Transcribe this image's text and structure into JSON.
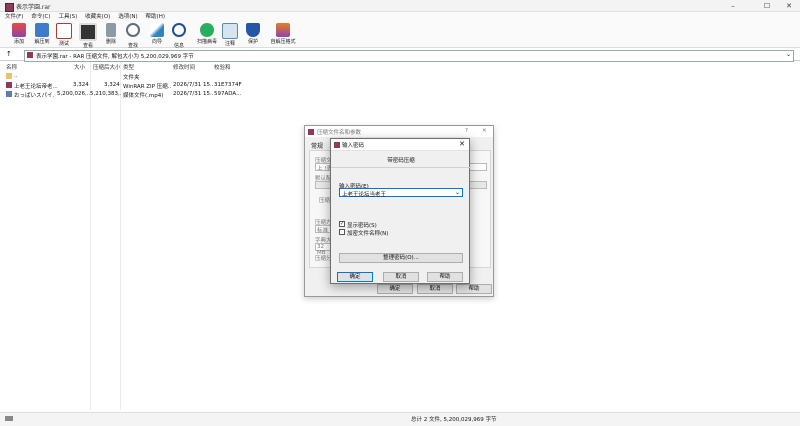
{
  "window": {
    "title": "表示学園.rar",
    "controls": [
      "–",
      "☐",
      "✕"
    ]
  },
  "menu": [
    "文件(F)",
    "命令(C)",
    "工具(S)",
    "收藏夹(O)",
    "选项(N)",
    "帮助(H)"
  ],
  "toolbar": [
    {
      "label": "添加",
      "icon": "add-archive-icon",
      "color": "#c0392b"
    },
    {
      "label": "解压到",
      "icon": "extract-to-icon",
      "color": "#3d7cc9"
    },
    {
      "label": "测试",
      "icon": "test-icon",
      "color": "#b03a2e"
    },
    {
      "label": "查看",
      "icon": "view-icon",
      "color": "#444444"
    },
    {
      "label": "删除",
      "icon": "delete-icon",
      "color": "#7f8c8d"
    },
    {
      "label": "查找",
      "icon": "find-icon",
      "color": "#5d6d7e"
    },
    {
      "label": "向导",
      "icon": "wizard-icon",
      "color": "#2e86c1"
    },
    {
      "label": "信息",
      "icon": "info-icon",
      "color": "#1f4e9c"
    },
    {
      "label": "扫描病毒",
      "icon": "virus-scan-icon",
      "color": "#27ae60"
    },
    {
      "label": "注释",
      "icon": "comment-icon",
      "color": "#5d8aa8"
    },
    {
      "label": "保护",
      "icon": "protect-icon",
      "color": "#2457a6"
    },
    {
      "label": "自解压格式",
      "icon": "sfx-icon",
      "color": "#d35400"
    }
  ],
  "pathbar": {
    "up": "↑",
    "text": "表示学園.rar - RAR 压缩文件, 解包大小为 5,200,029,969 字节",
    "dropdown": "⌄"
  },
  "columns": [
    "名称",
    "大小",
    "压缩后大小",
    "类型",
    "修改时间",
    "校验和"
  ],
  "files": [
    {
      "name": "..",
      "size": "",
      "packed": "",
      "type": "文件夹",
      "modified": "",
      "crc": ""
    },
    {
      "name": "上老王论坛帝老...",
      "size": "3,324",
      "packed": "3,324",
      "type": "WinRAR ZIP 压缩...",
      "modified": "2026/7/31 15...",
      "crc": "31E7374F"
    },
    {
      "name": "おっぱいスパイ...",
      "size": "5,200,026,...",
      "packed": "5,210,383,...",
      "type": "媒体文件(.mp4)",
      "modified": "2026/7/31 15...",
      "crc": "597ADA..."
    }
  ],
  "status": {
    "left_icon": "drive-icon",
    "left": "",
    "right": "总计 2 文件, 5,200,029,969 字节"
  },
  "back_dialog": {
    "title": "压缩文件名和参数",
    "help": "?",
    "close": "✕",
    "tab_general": "常规",
    "labels": [
      "压缩文",
      "上 !表",
      "默认配",
      "压缩",
      "压缩方",
      "标准",
      "字典大",
      "32 MB",
      "压缩分"
    ],
    "ok": "确定",
    "cancel": "取消",
    "help_btn": "帮助"
  },
  "front_dialog": {
    "title": "输入密码",
    "close": "✕",
    "heading": "带密码压缩",
    "field_label": "输入密码(E)",
    "password_value": "上老王论坛当老王",
    "show_password": "显示密码(S)",
    "show_password_checked": true,
    "encrypt_names": "加密文件名称(N)",
    "encrypt_names_checked": false,
    "manage": "整理密码(O)...",
    "ok": "确定",
    "cancel": "取消",
    "help": "帮助"
  }
}
